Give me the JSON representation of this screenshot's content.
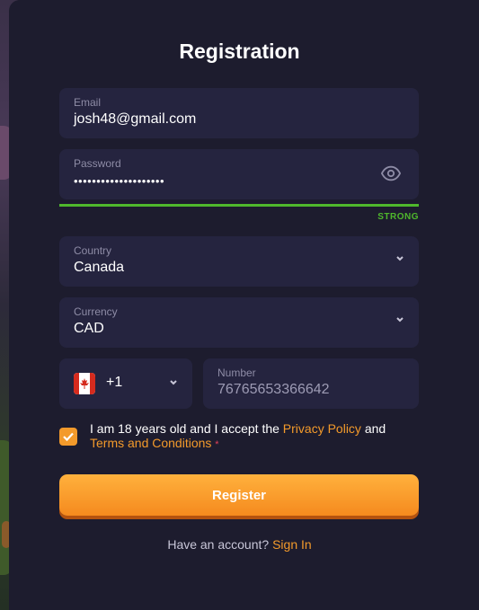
{
  "modal": {
    "title": "Registration"
  },
  "email": {
    "label": "Email",
    "value": "josh48@gmail.com"
  },
  "password": {
    "label": "Password",
    "value": "••••••••••••••••••••",
    "strength": "STRONG",
    "strength_color": "#4fb82c"
  },
  "country": {
    "label": "Country",
    "value": "Canada"
  },
  "currency": {
    "label": "Currency",
    "value": "CAD"
  },
  "phone": {
    "code": "+1",
    "label": "Number",
    "value": "76765653366642",
    "flag": "canada-flag-icon"
  },
  "consent": {
    "checked": true,
    "text_before": "I am 18 years old and I accept the ",
    "privacy_link": "Privacy Policy",
    "text_and": " and",
    "terms_link": "Terms and Conditions",
    "required_mark": "*"
  },
  "register_button": {
    "label": "Register"
  },
  "signin": {
    "prompt": "Have an account? ",
    "link": "Sign In"
  },
  "colors": {
    "accent": "#f39a2b",
    "modal_bg": "#1d1c2e",
    "field_bg": "#25243f"
  }
}
